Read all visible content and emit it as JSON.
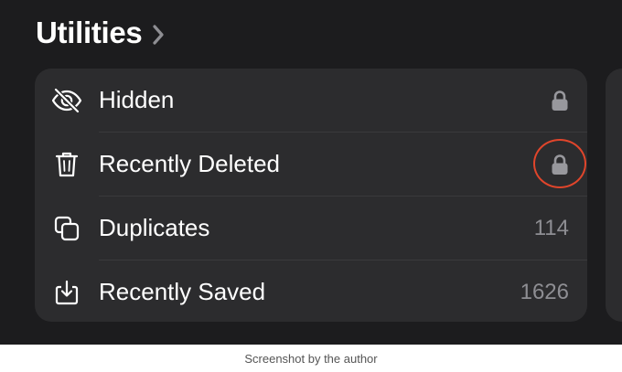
{
  "header": {
    "title": "Utilities",
    "chevron_icon": "chevron-right-icon"
  },
  "utilities": {
    "items": [
      {
        "label": "Hidden",
        "icon": "eye-slash-icon",
        "trailing_type": "lock",
        "trailing_icon": "lock-icon"
      },
      {
        "label": "Recently Deleted",
        "icon": "trash-icon",
        "trailing_type": "lock",
        "trailing_icon": "lock-icon",
        "highlighted": true
      },
      {
        "label": "Duplicates",
        "icon": "duplicates-icon",
        "trailing_type": "count",
        "count": "114"
      },
      {
        "label": "Recently Saved",
        "icon": "tray-download-icon",
        "trailing_type": "count",
        "count": "1626"
      }
    ]
  },
  "caption": "Screenshot by the author",
  "colors": {
    "background": "#1c1c1e",
    "card": "#2c2c2e",
    "text": "#ffffff",
    "secondary_text": "#8e8e93",
    "highlight": "#e0452b"
  }
}
